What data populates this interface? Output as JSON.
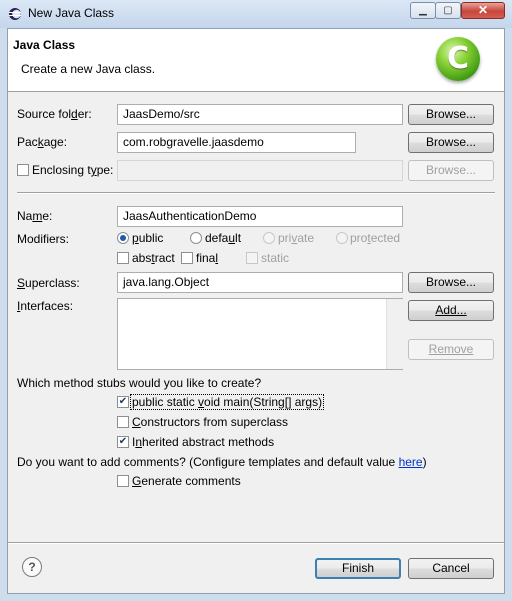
{
  "window": {
    "title": "New Java Class",
    "min_icon": "minimize-icon",
    "max_icon": "maximize-icon",
    "close_glyph": "✕",
    "min_glyph": "▁",
    "max_glyph": "▢"
  },
  "banner": {
    "title": "Java Class",
    "description": "Create a new Java class.",
    "icon_letter": "C",
    "icon_color": "#5cb81e"
  },
  "form": {
    "source_folder": {
      "label_pre": "Source fol",
      "label_u": "d",
      "label_post": "er:",
      "value": "JaasDemo/src",
      "button": "Browse..."
    },
    "package": {
      "label_pre": "Pac",
      "label_u": "k",
      "label_post": "age:",
      "value": "com.robgravelle.jaasdemo",
      "button": "Browse..."
    },
    "enclosing_type": {
      "label_pre": "Enclosing t",
      "label_u": "y",
      "label_post": "pe:",
      "value": "",
      "button": "Browse...",
      "checked": false
    },
    "name": {
      "label_pre": "Na",
      "label_u": "m",
      "label_post": "e:",
      "value": "JaasAuthenticationDemo"
    },
    "modifiers": {
      "label": "Modifiers:",
      "radios": [
        {
          "pre": "",
          "u": "p",
          "post": "ublic",
          "selected": true,
          "enabled": true
        },
        {
          "pre": "defa",
          "u": "u",
          "post": "lt",
          "selected": false,
          "enabled": true
        },
        {
          "pre": "pri",
          "u": "v",
          "post": "ate",
          "selected": false,
          "enabled": false
        },
        {
          "pre": "pro",
          "u": "t",
          "post": "ected",
          "selected": false,
          "enabled": false
        }
      ],
      "checks": [
        {
          "pre": "abs",
          "u": "t",
          "post": "ract",
          "checked": false,
          "enabled": true
        },
        {
          "pre": "fina",
          "u": "l",
          "post": "",
          "checked": false,
          "enabled": true
        },
        {
          "pre": "static",
          "u": "",
          "post": "",
          "checked": false,
          "enabled": false
        }
      ]
    },
    "superclass": {
      "label_pre": "",
      "label_u": "S",
      "label_post": "uperclass:",
      "value": "java.lang.Object",
      "button": "Browse..."
    },
    "interfaces": {
      "label_pre": "",
      "label_u": "I",
      "label_post": "nterfaces:",
      "add_button": "Add...",
      "remove_button": "Remove"
    },
    "stubs": {
      "question": "Which method stubs would you like to create?",
      "options": [
        {
          "pre": "public static ",
          "u": "v",
          "post": "oid main(String[] args)",
          "checked": true
        },
        {
          "pre": "",
          "u": "C",
          "post": "onstructors from superclass",
          "checked": false
        },
        {
          "pre": "I",
          "u": "n",
          "post": "herited abstract methods",
          "checked": true
        }
      ]
    },
    "comments": {
      "question_pre": "Do you want to add comments? (Configure templates and default value ",
      "link": "here",
      "question_post": ")",
      "option": {
        "pre": "",
        "u": "G",
        "post": "enerate comments",
        "checked": false
      }
    }
  },
  "footer": {
    "help_glyph": "?",
    "finish": "Finish",
    "cancel": "Cancel"
  },
  "colors": {
    "accent": "#3c7fb1",
    "link": "#0033cc",
    "frame": "#cfdceb"
  },
  "check_glyph": "✔"
}
